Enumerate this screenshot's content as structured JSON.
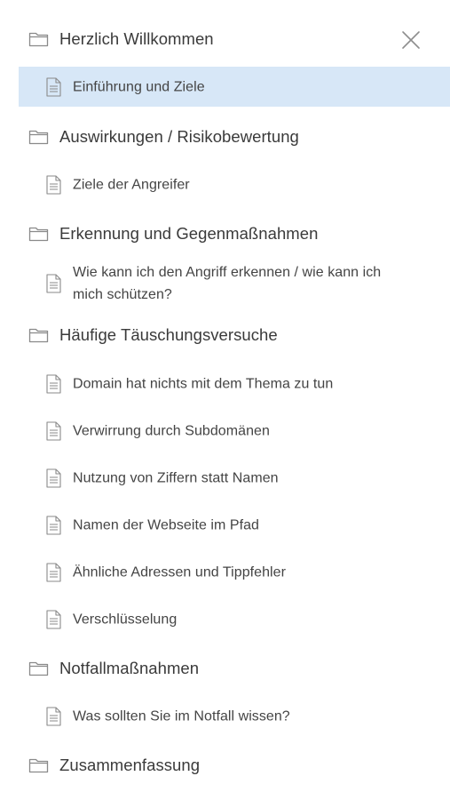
{
  "toc": {
    "sections": [
      {
        "title": "Herzlich Willkommen",
        "pages": [
          {
            "title": "Einführung und Ziele",
            "active": true
          }
        ]
      },
      {
        "title": "Auswirkungen / Risikobewertung",
        "pages": [
          {
            "title": "Ziele der Angreifer",
            "active": false
          }
        ]
      },
      {
        "title": "Erkennung und Gegenmaßnahmen",
        "pages": [
          {
            "title": "Wie kann ich den Angriff erkennen / wie kann ich mich schützen?",
            "active": false
          }
        ]
      },
      {
        "title": "Häufige Täuschungsversuche",
        "pages": [
          {
            "title": "Domain hat nichts mit dem Thema zu tun",
            "active": false
          },
          {
            "title": "Verwirrung durch Subdomänen",
            "active": false
          },
          {
            "title": "Nutzung von Ziffern statt Namen",
            "active": false
          },
          {
            "title": "Namen der Webseite im Pfad",
            "active": false
          },
          {
            "title": "Ähnliche Adressen und Tippfehler",
            "active": false
          },
          {
            "title": "Verschlüsselung",
            "active": false
          }
        ]
      },
      {
        "title": "Notfallmaßnahmen",
        "pages": [
          {
            "title": "Was sollten Sie im Notfall wissen?",
            "active": false
          }
        ]
      },
      {
        "title": "Zusammenfassung",
        "pages": []
      }
    ]
  },
  "close_icon": "close-icon",
  "colors": {
    "active_background": "#d7e7f7",
    "text": "#3c3c3c",
    "icon": "#8a8a8a"
  }
}
